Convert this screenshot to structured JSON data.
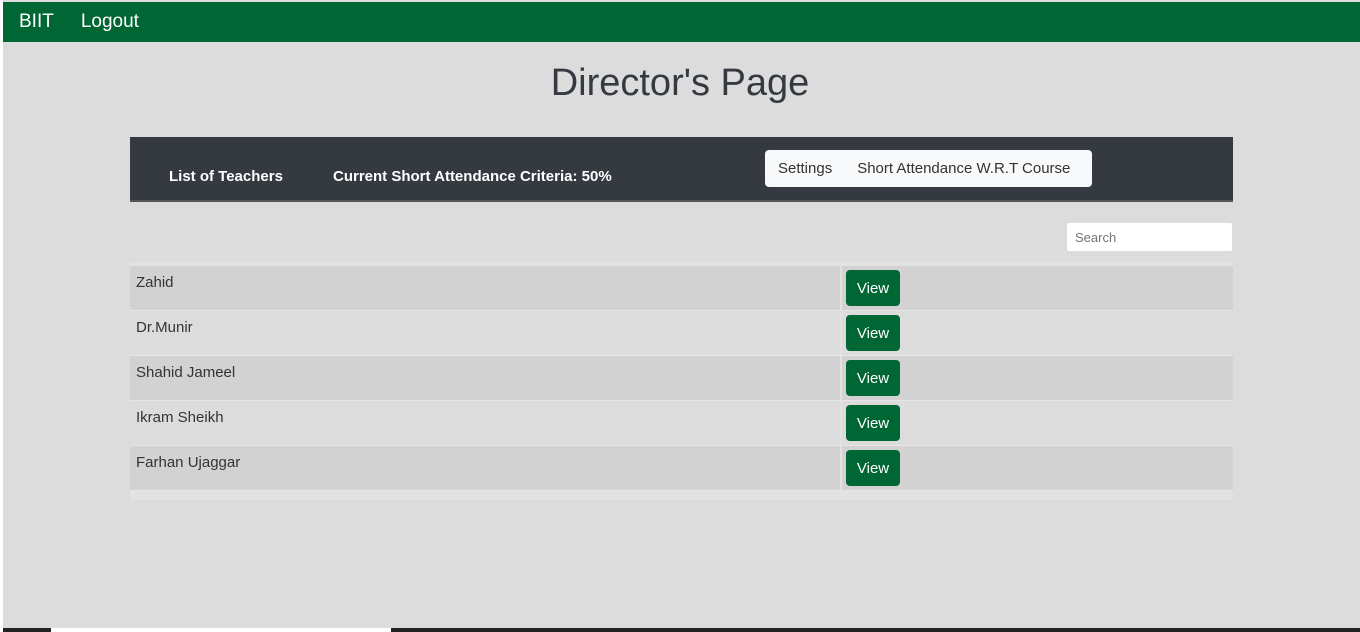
{
  "nav": {
    "brand": "BIIT",
    "logout": "Logout"
  },
  "title": "Director's Page",
  "toolbar": {
    "teachers": "List of Teachers",
    "criteria": "Current Short Attendance Criteria: 50%",
    "settings": "Settings",
    "short_attendance": "Short Attendance W.R.T Course"
  },
  "search": {
    "placeholder": "Search"
  },
  "teachers": [
    {
      "name": "Zahid",
      "action": "View"
    },
    {
      "name": "Dr.Munir",
      "action": "View"
    },
    {
      "name": "Shahid Jameel",
      "action": "View"
    },
    {
      "name": "Ikram Sheikh",
      "action": "View"
    },
    {
      "name": "Farhan Ujaggar",
      "action": "View"
    }
  ]
}
